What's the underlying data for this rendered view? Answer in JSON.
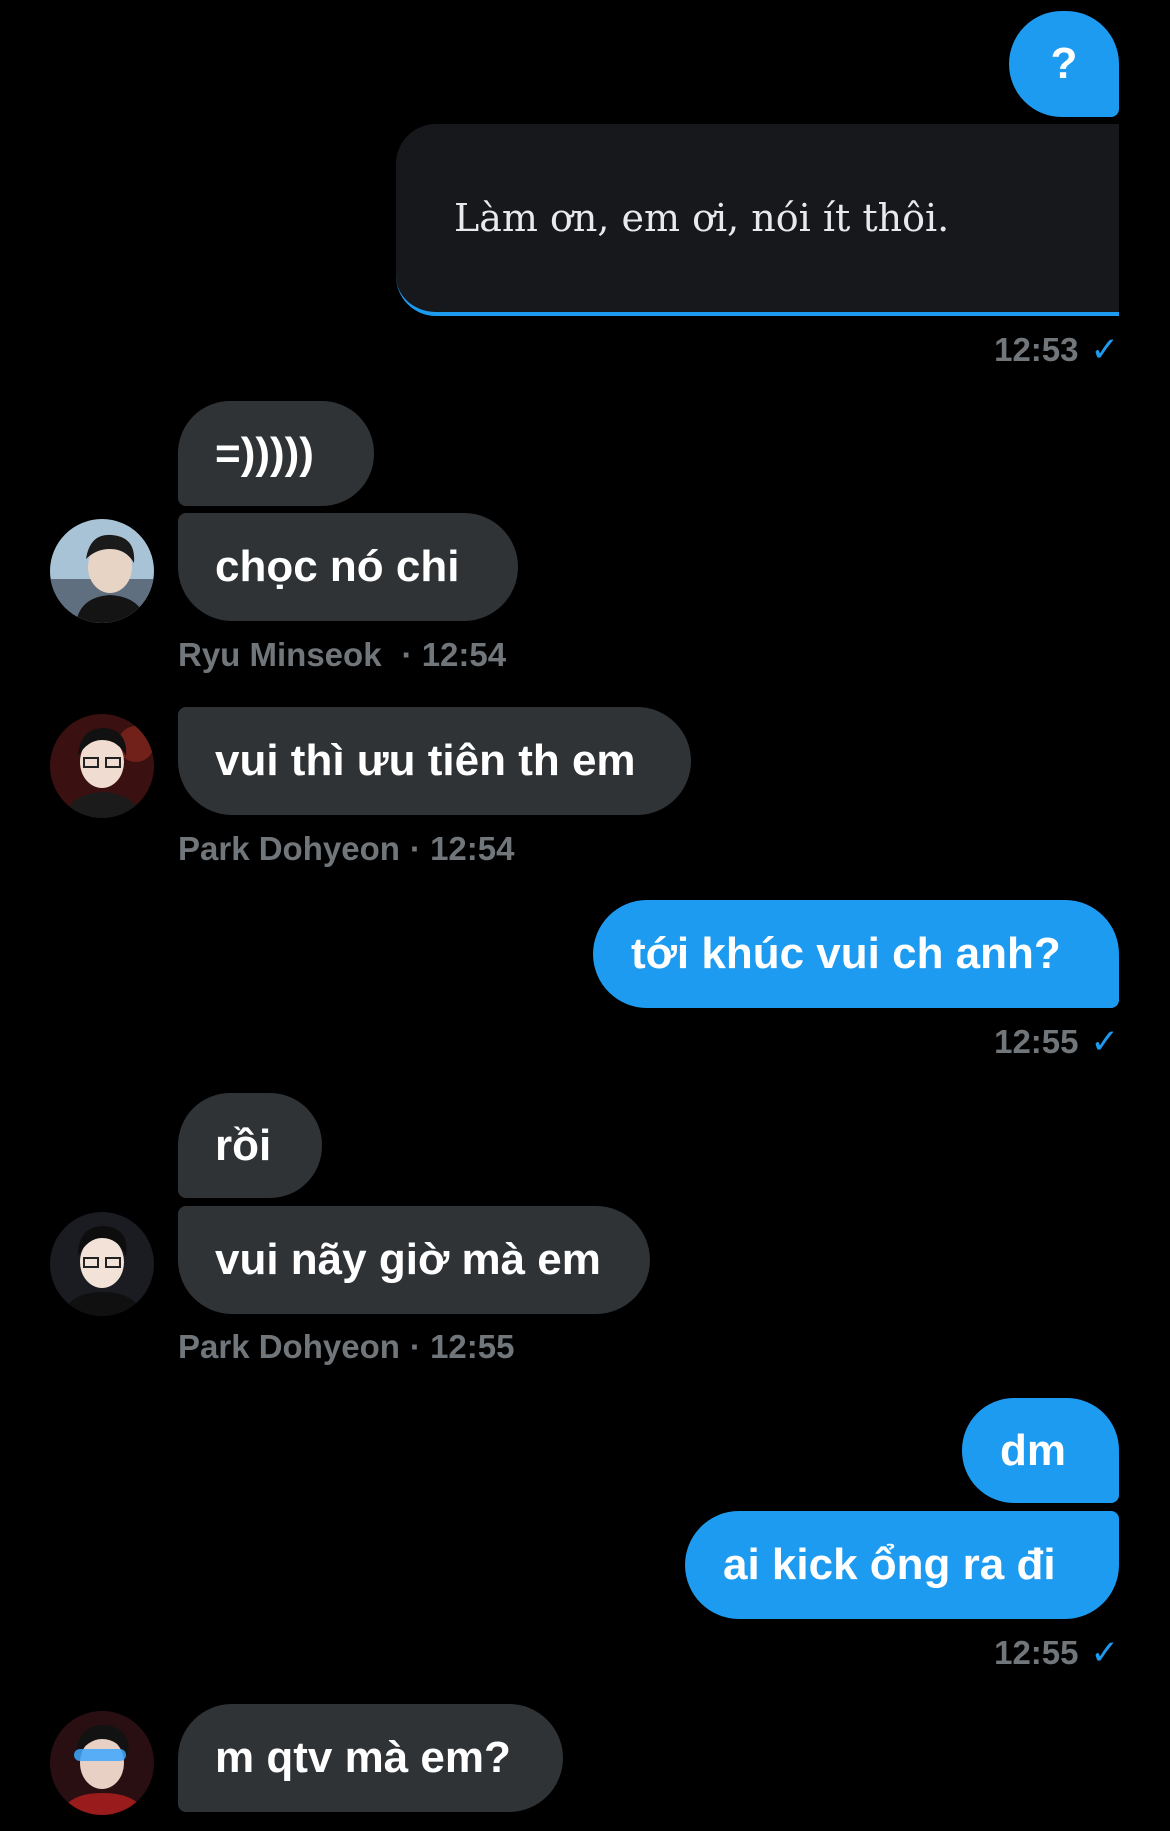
{
  "colors": {
    "background": "#000000",
    "outgoing_bubble": "#1d9bf0",
    "incoming_bubble": "#2f3336",
    "quote_card": "#16181c",
    "meta_text": "#71767b",
    "check": "#1d9bf0"
  },
  "messages": {
    "m1": {
      "text": "?"
    },
    "quote": {
      "text": "Làm ơn, em ơi, nói ít thôi."
    },
    "meta1": {
      "time": "12:53",
      "icon": "check-icon"
    },
    "m2": {
      "text": "=)))))"
    },
    "m3": {
      "text": "chọc nó chi"
    },
    "meta2": {
      "sender": "Ryu Minseok",
      "time": "· 12:54"
    },
    "m4": {
      "text": "vui thì ưu tiên th em"
    },
    "meta3": {
      "sender": "Park Dohyeon",
      "time": "· 12:54"
    },
    "m5": {
      "text": "tới khúc vui ch anh?"
    },
    "meta4": {
      "time": "12:55",
      "icon": "check-icon"
    },
    "m6": {
      "text": "rồi"
    },
    "m7": {
      "text": "vui nãy giờ mà em"
    },
    "meta5": {
      "sender": "Park Dohyeon",
      "time": "· 12:55"
    },
    "m8": {
      "text": "dm"
    },
    "m9": {
      "text": "ai kick ổng ra đi"
    },
    "meta6": {
      "time": "12:55",
      "icon": "check-icon"
    },
    "m10": {
      "text": "m qtv mà em?"
    }
  }
}
